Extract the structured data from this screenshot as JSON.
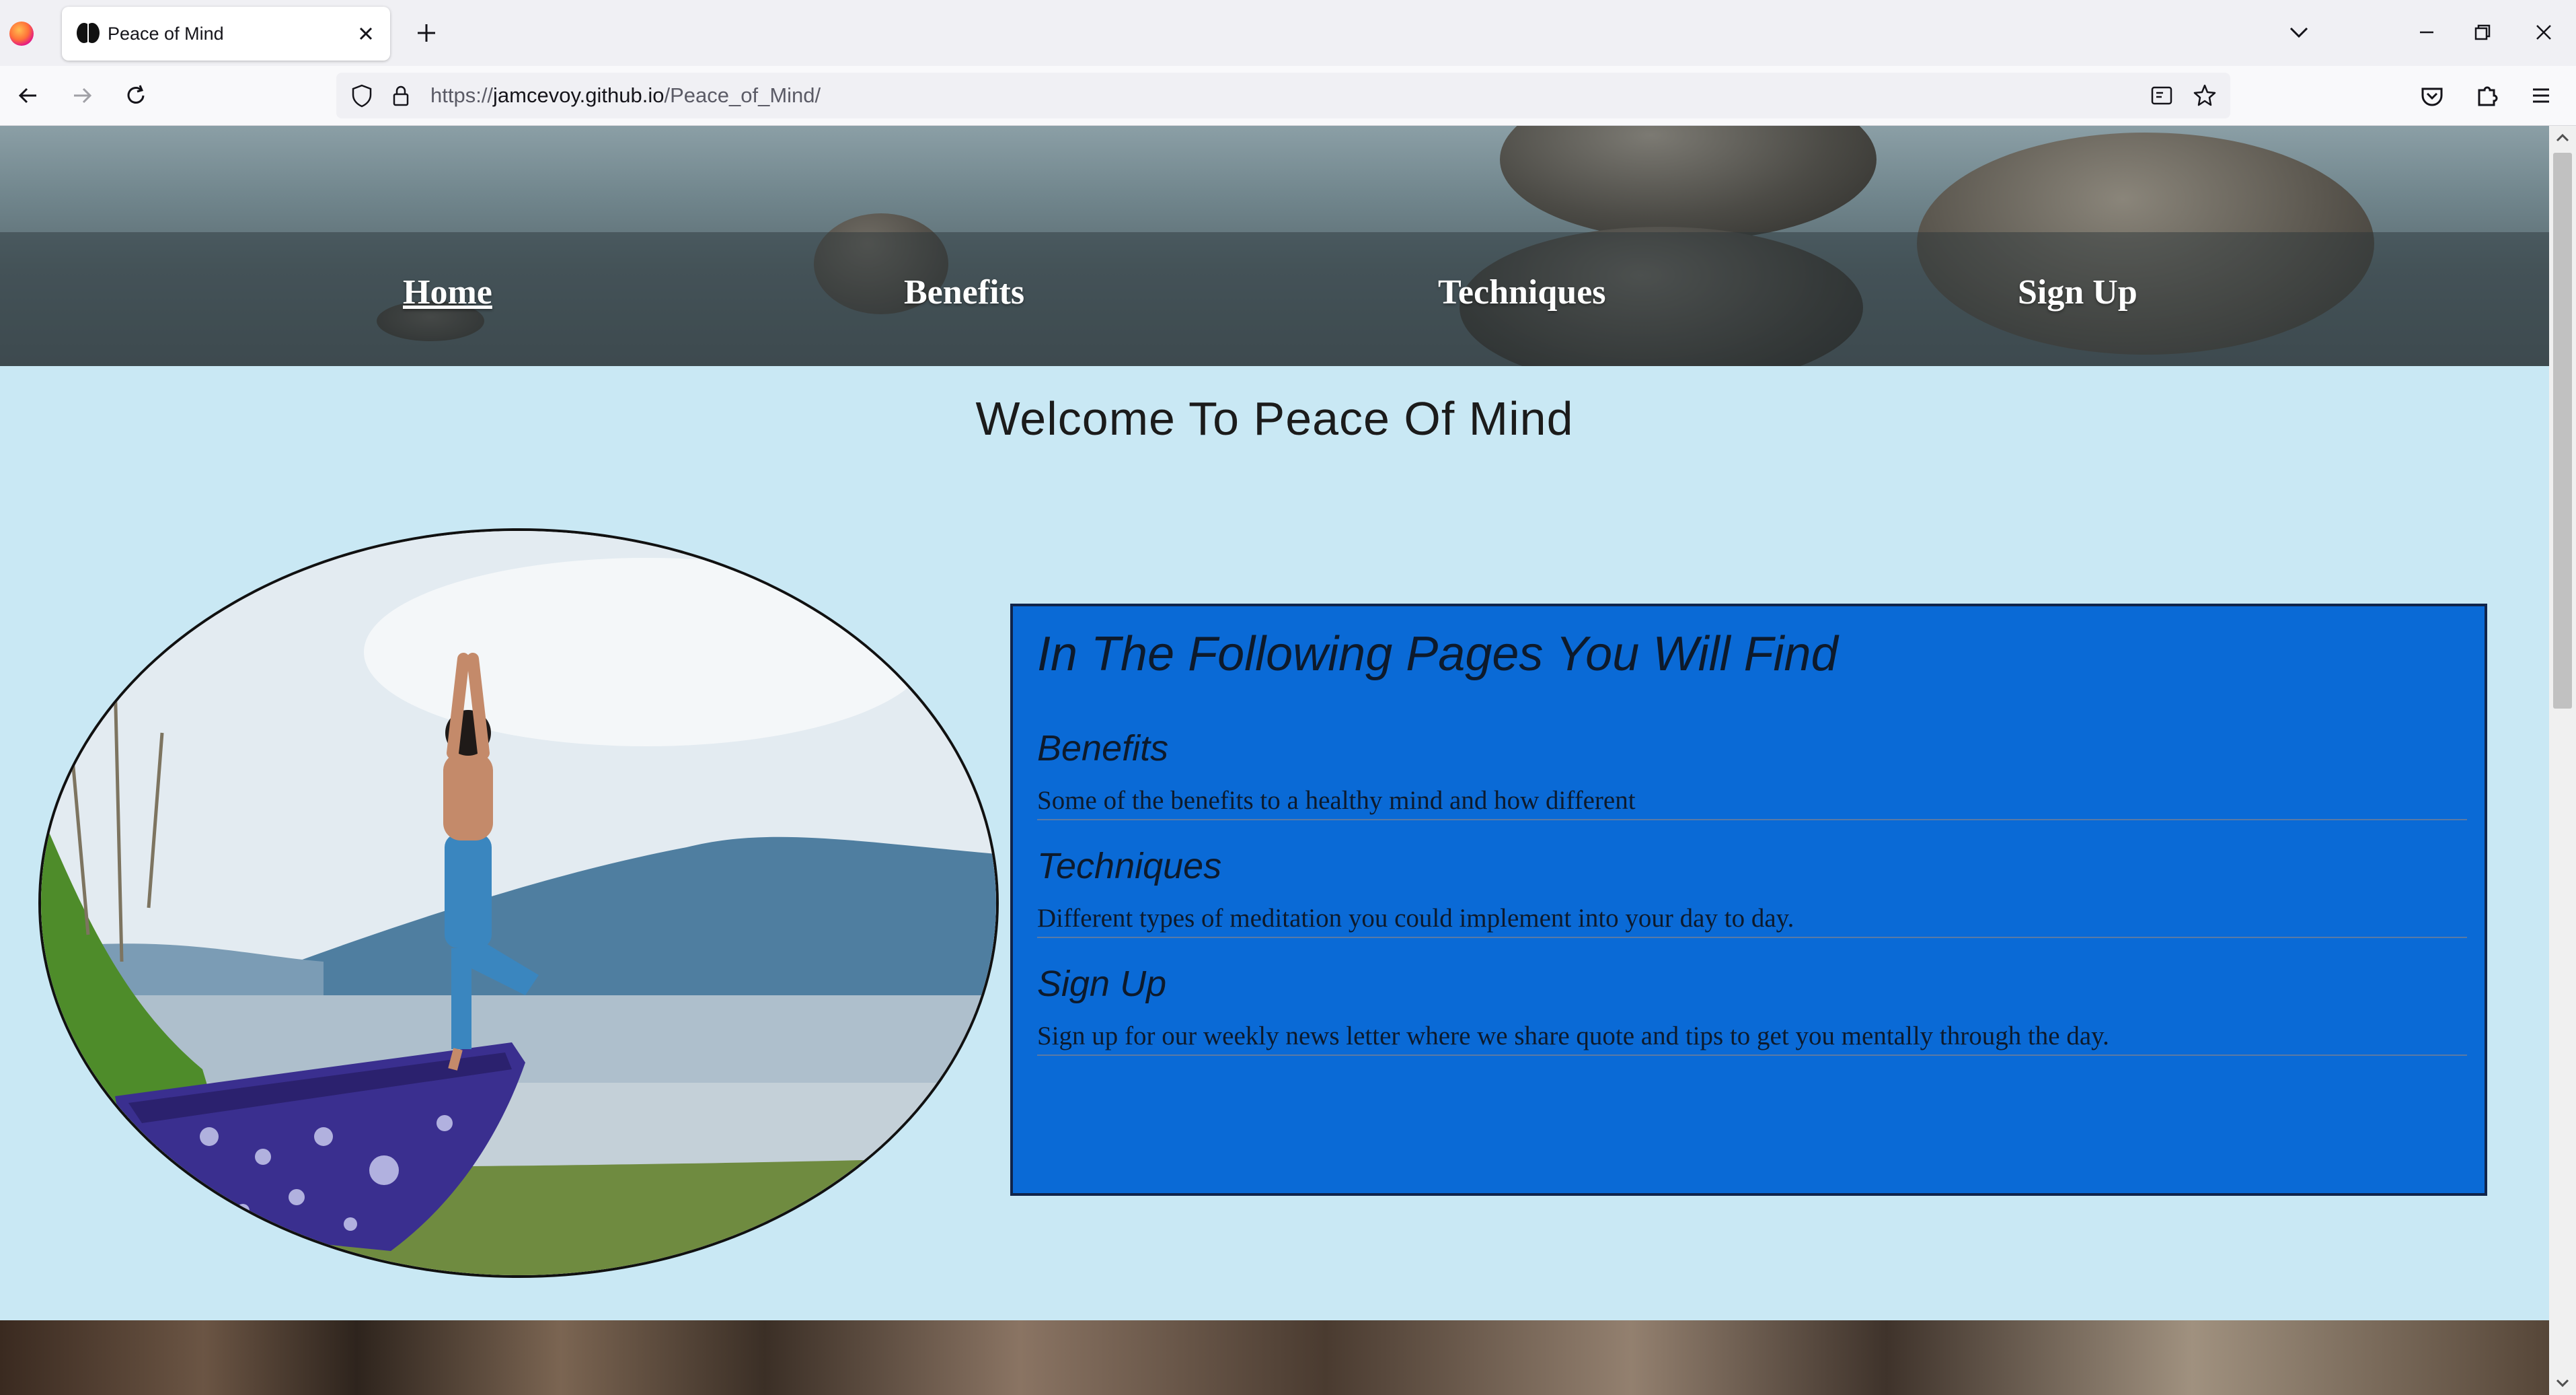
{
  "browser": {
    "tab_title": "Peace of Mind",
    "url_scheme": "https://",
    "url_host": "jamcevoy.github.io",
    "url_path": "/Peace_of_Mind/",
    "icons": [
      "firefox-logo-icon",
      "brain-favicon-icon",
      "close-icon",
      "plus-icon",
      "chevron-down-icon",
      "minimize-icon",
      "restore-icon",
      "close-window-icon",
      "back-arrow-icon",
      "forward-arrow-icon",
      "reload-icon",
      "shield-icon",
      "lock-icon",
      "reader-view-icon",
      "bookmark-star-icon",
      "pocket-icon",
      "extensions-icon",
      "menu-icon"
    ]
  },
  "site": {
    "nav": {
      "home": "Home",
      "benefits": "Benefits",
      "techniques": "Techniques",
      "signup": "Sign Up"
    },
    "welcome": "Welcome To Peace Of Mind",
    "info": {
      "title": "In The Following Pages You Will Find",
      "sections": [
        {
          "heading": "Benefits",
          "text": "Some of the benefits to a healthy mind and how different"
        },
        {
          "heading": "Techniques",
          "text": "Different types of meditation you could implement into your day to day."
        },
        {
          "heading": "Sign Up",
          "text": "Sign up for our weekly news letter where we share quote and tips to get you mentally through the day."
        }
      ]
    }
  },
  "colors": {
    "page_background": "#c9e8f4",
    "info_box": "#0a6ad6"
  }
}
